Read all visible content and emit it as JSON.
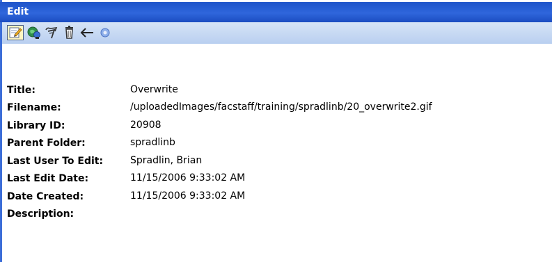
{
  "window": {
    "title": "Edit"
  },
  "toolbar": {
    "buttons": [
      {
        "icon": "edit-properties-icon",
        "active": true
      },
      {
        "icon": "view-link-icon",
        "active": false
      },
      {
        "icon": "overwrite-icon",
        "active": false
      },
      {
        "icon": "delete-trash-icon",
        "active": false
      },
      {
        "icon": "back-arrow-icon",
        "active": false
      },
      {
        "icon": "help-icon",
        "active": false
      }
    ]
  },
  "fields": [
    {
      "label": "Title:",
      "value": "Overwrite"
    },
    {
      "label": "Filename:",
      "value": "/uploadedImages/facstaff/training/spradlinb/20_overwrite2.gif"
    },
    {
      "label": "Library ID:",
      "value": "20908"
    },
    {
      "label": "Parent Folder:",
      "value": "spradlinb"
    },
    {
      "label": "Last User To Edit:",
      "value": "Spradlin, Brian"
    },
    {
      "label": "Last Edit Date:",
      "value": "11/15/2006 9:33:02 AM"
    },
    {
      "label": "Date Created:",
      "value": "11/15/2006 9:33:02 AM"
    },
    {
      "label": "Description:",
      "value": ""
    }
  ],
  "colors": {
    "titlebar": "#2f66dc",
    "toolbar": "#c7daf3",
    "active_button": "#fef6c3"
  }
}
